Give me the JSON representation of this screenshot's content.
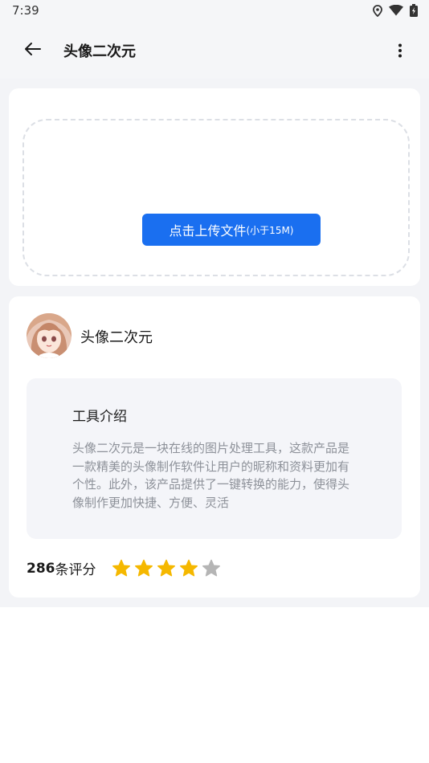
{
  "status_bar": {
    "time": "7:39",
    "icons": [
      "location-icon",
      "wifi-icon",
      "battery-icon"
    ]
  },
  "app_bar": {
    "title": "头像二次元",
    "back_icon": "arrow-left-icon",
    "more_icon": "more-vertical-icon"
  },
  "upload": {
    "button_label": "点击上传文件",
    "button_hint": "(小于15M)",
    "button_color": "#1a6ff0"
  },
  "tool": {
    "name": "头像二次元",
    "intro_title": "工具介绍",
    "intro_text": "头像二次元是一块在线的图片处理工具，这款产品是一款精美的头像制作软件让用户的昵称和资料更加有个性。此外，该产品提供了一键转换的能力，使得头像制作更加快捷、方便、灵活"
  },
  "rating": {
    "count": "286",
    "label": "条评分",
    "stars_filled": 4,
    "stars_total": 5,
    "star_color": "#f5b800",
    "star_empty_color": "#b5b5b5"
  }
}
